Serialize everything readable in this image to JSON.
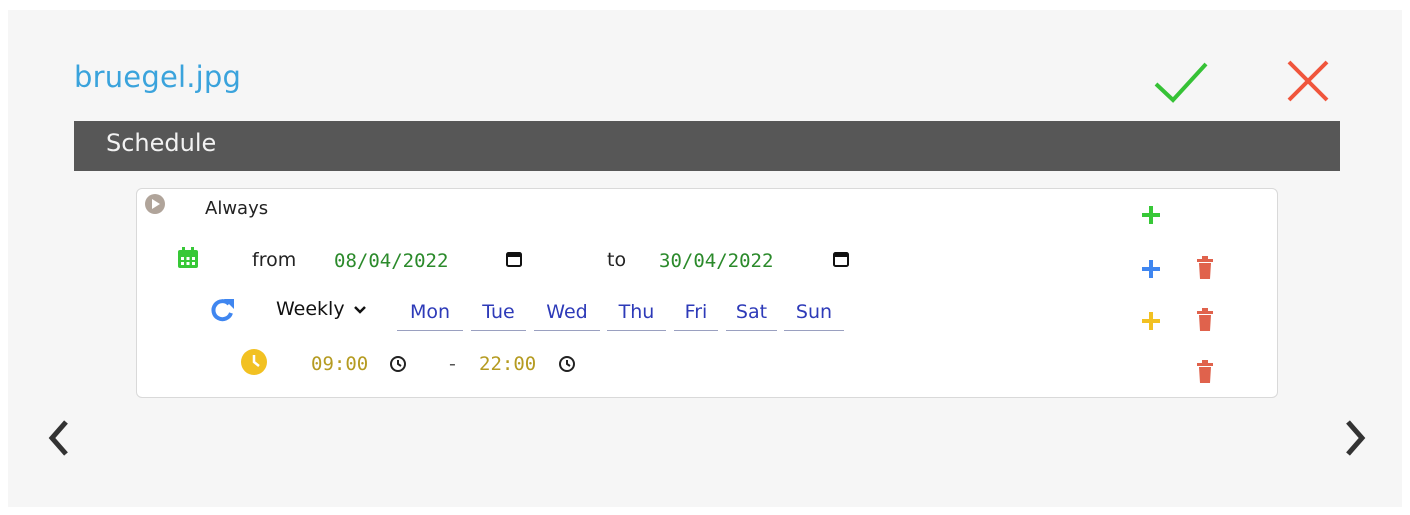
{
  "header": {
    "filename": "bruegel.jpg",
    "confirm_icon": "checkmark-icon",
    "cancel_icon": "close-icon"
  },
  "section": {
    "title": "Schedule"
  },
  "schedule": {
    "always_label": "Always",
    "date_range": {
      "from_label": "from",
      "from_value": "08/04/2022",
      "to_label": "to",
      "to_value": "30/04/2022"
    },
    "recurrence": {
      "frequency": "Weekly",
      "days": [
        "Mon",
        "Tue",
        "Wed",
        "Thu",
        "Fri",
        "Sat",
        "Sun"
      ]
    },
    "time_range": {
      "start": "09:00",
      "separator": "-",
      "end": "22:00"
    }
  },
  "colors": {
    "title": "#3aa3dc",
    "confirm": "#36c236",
    "cancel": "#f0553c",
    "header_bar": "#575757",
    "add_green": "#37c837",
    "add_blue": "#3f86f0",
    "add_yellow": "#f2c122",
    "delete": "#e0624c",
    "calendar_icon": "#37c837",
    "repeat_icon": "#3f86f0",
    "clock_icon": "#f2c122",
    "play_icon": "#b0a49a"
  }
}
